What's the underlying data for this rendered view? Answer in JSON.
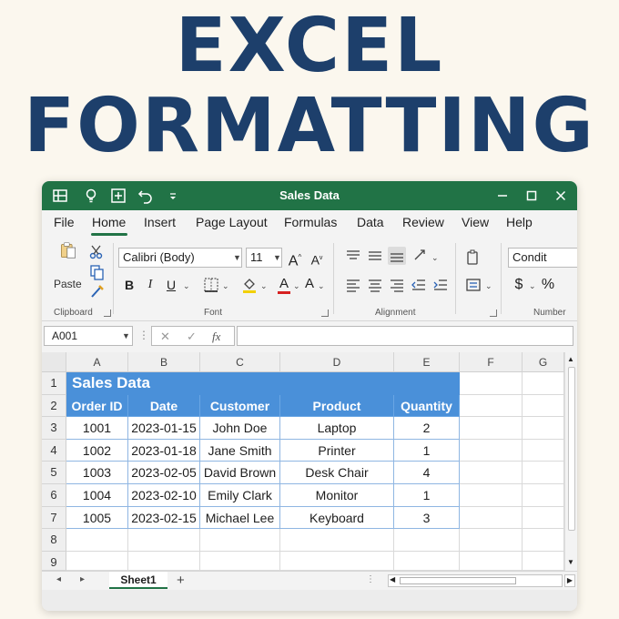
{
  "headline": {
    "line1": "EXCEL",
    "line2": "FORMATTING"
  },
  "titlebar": {
    "title": "Sales Data",
    "minimize": "✕",
    "ctrl_min": "—",
    "ctrl_max": "☐",
    "ctrl_close": "✕"
  },
  "menu": [
    "File",
    "Home",
    "Insert",
    "Page Layout",
    "Formulas",
    "Data",
    "Review",
    "View",
    "Help"
  ],
  "ribbon": {
    "paste_label": "Paste",
    "font_name": "Calibri (Body)",
    "font_size": "11",
    "grow_font": "A",
    "shrink_font": "A",
    "bold": "B",
    "italic": "I",
    "underline": "U",
    "font_color_letter": "A",
    "font_color_letter2": "A",
    "currency": "$",
    "percent": "%",
    "cond_format": "Condit",
    "groups": {
      "clipboard": "Clipboard",
      "font": "Font",
      "alignment": "Alignment",
      "number": "Number"
    }
  },
  "formula_bar": {
    "name_box": "A001",
    "fx": "fx",
    "cancel": "✕",
    "enter": "✓",
    "value": ""
  },
  "grid": {
    "columns": [
      "A",
      "B",
      "C",
      "D",
      "E",
      "F",
      "G"
    ],
    "rows": [
      "1",
      "2",
      "3",
      "4",
      "5",
      "6",
      "7",
      "8",
      "9"
    ],
    "title": "Sales Data",
    "headers": [
      "Order ID",
      "Date",
      "Customer",
      "Product",
      "Quantity"
    ],
    "data": [
      [
        "1001",
        "2023-01-15",
        "John Doe",
        "Laptop",
        "2"
      ],
      [
        "1002",
        "2023-01-18",
        "Jane Smith",
        "Printer",
        "1"
      ],
      [
        "1003",
        "2023-02-05",
        "David Brown",
        "Desk Chair",
        "4"
      ],
      [
        "1004",
        "2023-02-10",
        "Emily Clark",
        "Monitor",
        "1"
      ],
      [
        "1005",
        "2023-02-15",
        "Michael Lee",
        "Keyboard",
        "3"
      ]
    ]
  },
  "sheets": {
    "active": "Sheet1",
    "add": "+"
  },
  "colors": {
    "excel_green": "#217346",
    "header_blue": "#4a90d9",
    "headline_navy": "#1d3f6b"
  }
}
